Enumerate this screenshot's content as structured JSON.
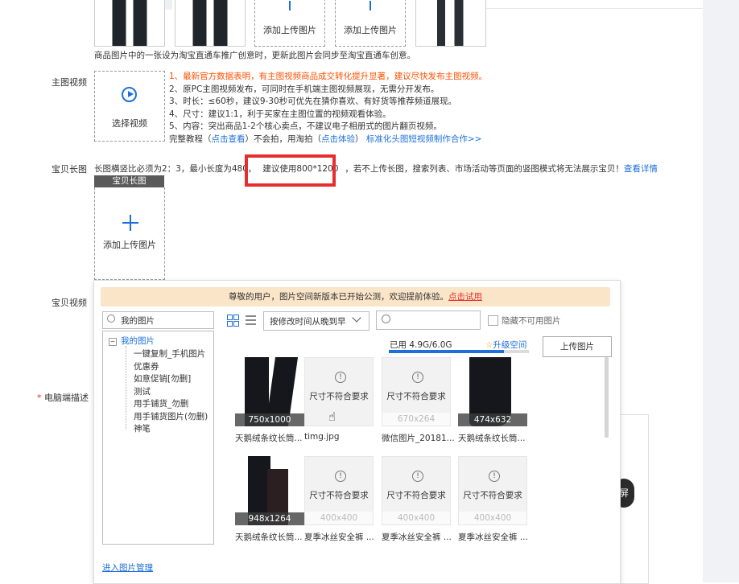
{
  "top_thumbs": {
    "add_label_1": "添加上传图片",
    "add_label_2": "添加上传图片"
  },
  "main_image_note": "商品图片中的一张设为淘宝直通车推广创意时，更新此图片会同步至淘宝直通车创意。",
  "main_video": {
    "label": "主图视频",
    "select_label": "选择视频",
    "notes": [
      "1、最新官方数据表明，有主图视频商品成交转化提升显著，建议尽快发布主图视频。",
      "2、原PC主图视频发布，可同时在手机端主图视频展现，无需分开发布。",
      "3、时长：≤60秒，建议9-30秒可优先在猜你喜欢、有好货等推荐频道展现。",
      "4、尺寸：建议1:1，利于买家在主图位置的视频观看体验。",
      "5、内容：突出商品1-2个核心卖点，不建议电子相册式的图片翻页视频。"
    ],
    "tutorial_prefix": "完整教程（",
    "tutorial_link": "点击查看",
    "tutorial_mid": "）不会拍，用淘拍（",
    "tutorial_link2": "点击体验",
    "tutorial_suffix": "）",
    "standard_link": "标准化头图短视频制作合作>>"
  },
  "long_image": {
    "label": "宝贝长图",
    "desc_before": "长图横竖比必须为2：3，最小长度为480，",
    "highlight": "建议使用800*1200",
    "desc_after": "，若不上传长图，搜索列表、市场活动等页面的竖图模式将无法展示宝贝！",
    "detail_link": "查看详情",
    "header": "宝贝长图",
    "add_label": "添加上传图片"
  },
  "item_video_label": "宝贝视频",
  "pc_desc_label": "电脑端描述",
  "required_mark": "*",
  "fullscreen_label": "屏",
  "picker": {
    "notice_text": "尊敬的用户，图片空间新版本已开始公测，欢迎提前体验。",
    "notice_link": "点击试用",
    "tree_search_placeholder": "我的图片",
    "tree": {
      "root": "我的图片",
      "children": [
        "一键复制_手机图片",
        "优惠券",
        "如意促销[勿删]",
        "测试",
        "用手铺货_勿删",
        "用手铺货图片(勿删)",
        "神笔"
      ]
    },
    "sort_select": "按修改时间从晚到早",
    "search_placeholder": "",
    "hide_unusable": "隐藏不可用图片",
    "storage_used": "已用 4.9G/6.0G",
    "storage_fraction": 0.82,
    "upgrade_label": "升级空间",
    "upload_button": "上传图片",
    "images": [
      {
        "caption": "天鹅绒条纹长筒...",
        "size": "750x1000",
        "status": "ok"
      },
      {
        "caption": "timg.jpg",
        "size": "",
        "status": "尺寸不符合要求"
      },
      {
        "caption": "微信图片_20181...",
        "size": "670x264",
        "status": "尺寸不符合要求"
      },
      {
        "caption": "天鹅绒条纹长筒...",
        "size": "474x632",
        "status": "ok"
      },
      {
        "caption": "天鹅绒条纹长筒...",
        "size": "948x1264",
        "status": "ok"
      },
      {
        "caption": "夏季冰丝安全裤 ...",
        "size": "400x400",
        "status": "尺寸不符合要求"
      },
      {
        "caption": "夏季冰丝安全裤 ...",
        "size": "400x400",
        "status": "尺寸不符合要求"
      },
      {
        "caption": "夏季冰丝安全裤 ...",
        "size": "400x400",
        "status": "尺寸不符合要求"
      }
    ],
    "manage_link": "进入图片管理"
  },
  "colors": {
    "accent": "#1e6fd9",
    "warning_orange": "#ff5000",
    "highlight_border": "#e62e2e",
    "notice_bg": "#fae5c8"
  }
}
